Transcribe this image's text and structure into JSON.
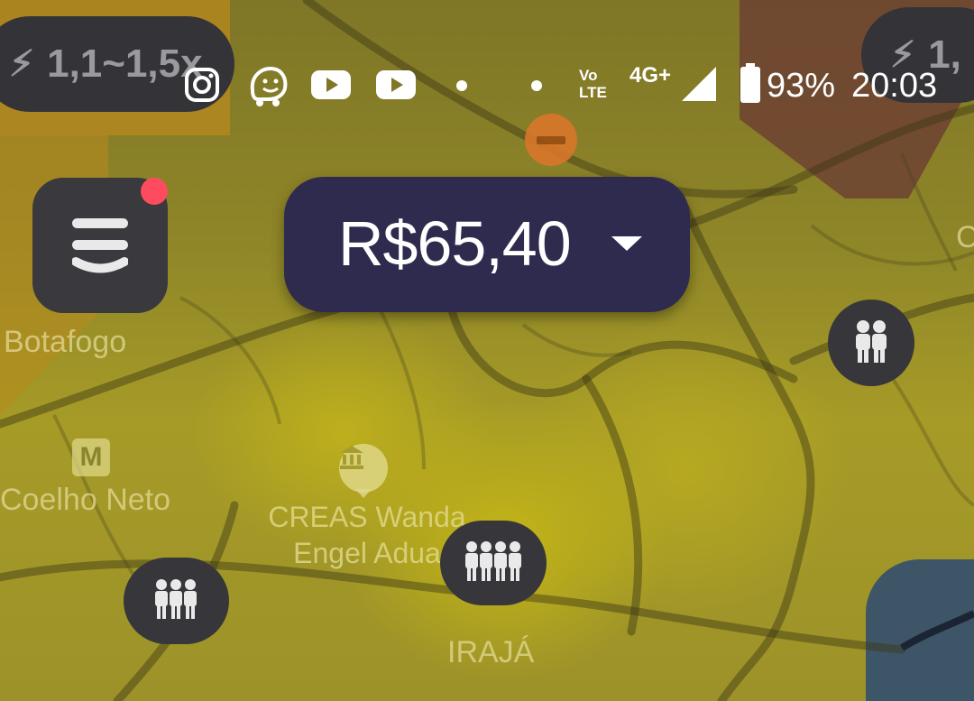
{
  "status_bar": {
    "app_icons": [
      "instagram-icon",
      "waze-icon",
      "youtube-icon",
      "youtube-icon",
      "dot-icon",
      "dot-icon"
    ],
    "volte_line1": "Vo",
    "volte_line2": "LTE",
    "network": "4G+",
    "battery": "93%",
    "time": "20:03"
  },
  "surge_left": {
    "label": "1,1~1,5x"
  },
  "surge_right": {
    "label": "1,"
  },
  "fare": {
    "value": "R$65,40"
  },
  "map": {
    "places": {
      "botafogo": "Botafogo",
      "coelho_neto": "Coelho Neto",
      "creas_line1": "CREAS Wanda",
      "creas_line2": "Engel Adua",
      "iraja": "IRAJÁ",
      "right_edge": "C"
    },
    "metro_badge": "M",
    "zone_colors": {
      "yellow": "#a69b27",
      "orange": "#b88a1e",
      "red": "#6a3a34",
      "blue": "#2c4a72"
    }
  },
  "crowd_markers": [
    {
      "people": 2
    },
    {
      "people": 4
    },
    {
      "people": 3
    }
  ]
}
